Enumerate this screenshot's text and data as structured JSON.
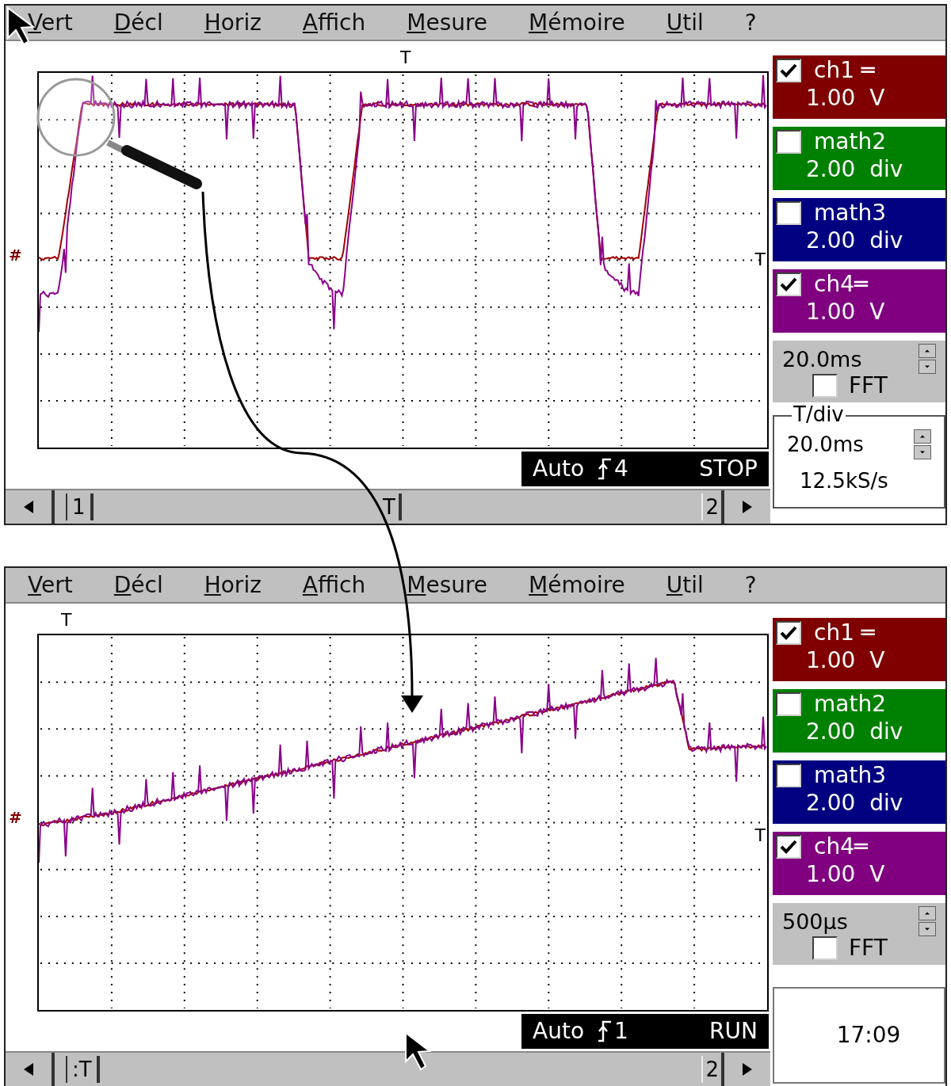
{
  "screens": [
    {
      "menu": [
        "Vert",
        "Décl",
        "Horiz",
        "Affich",
        "Mesure",
        "Mémoire",
        "Util",
        "?"
      ],
      "plot": {
        "kind": "pulses",
        "top_marker": "T",
        "right_marker": "T",
        "ground_marker": "#"
      },
      "channels": [
        {
          "name": "ch1 ═",
          "scale": "1.00  V",
          "color": "#800000",
          "checked": true
        },
        {
          "name": "math2",
          "scale": "2.00  div",
          "color": "#008000",
          "checked": false
        },
        {
          "name": "math3",
          "scale": "2.00  div",
          "color": "#000080",
          "checked": false
        },
        {
          "name": "ch4═",
          "scale": "1.00  V",
          "color": "#800080",
          "checked": true
        }
      ],
      "timebase": {
        "value": "20.0ms",
        "fft_label": "FFT",
        "fft_checked": false
      },
      "info_box": {
        "kind": "tdiv",
        "legend": "T/div",
        "value": "20.0ms",
        "rate": "12.5kS/s"
      },
      "status": {
        "mode": "Auto",
        "trigger_source": "4",
        "state": "STOP"
      },
      "scrollbar": {
        "left_marker": "1",
        "center_marker": "T",
        "right_marker": "2"
      }
    },
    {
      "menu": [
        "Vert",
        "Décl",
        "Horiz",
        "Affich",
        "Mesure",
        "Mémoire",
        "Util",
        "?"
      ],
      "plot": {
        "kind": "ramp",
        "top_marker": "T",
        "right_marker": "T",
        "ground_marker": "#"
      },
      "channels": [
        {
          "name": "ch1 ═",
          "scale": "1.00  V",
          "color": "#800000",
          "checked": true
        },
        {
          "name": "math2",
          "scale": "2.00  div",
          "color": "#008000",
          "checked": false
        },
        {
          "name": "math3",
          "scale": "2.00  div",
          "color": "#000080",
          "checked": false
        },
        {
          "name": "ch4═",
          "scale": "1.00  V",
          "color": "#800080",
          "checked": true
        }
      ],
      "timebase": {
        "value": "500µs",
        "fft_label": "FFT",
        "fft_checked": false
      },
      "info_box": {
        "kind": "clock",
        "time": "17:09"
      },
      "status": {
        "mode": "Auto",
        "trigger_source": "1",
        "state": "RUN"
      },
      "scrollbar": {
        "left_marker": ":T",
        "right_marker": "2"
      }
    }
  ]
}
